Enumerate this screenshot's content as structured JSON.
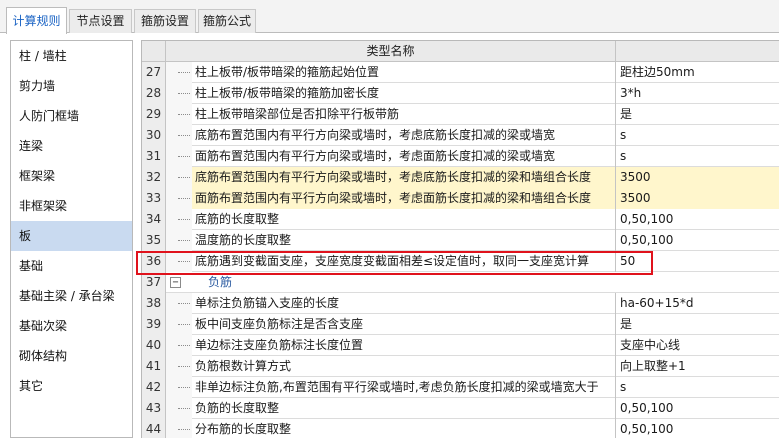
{
  "tabs": [
    {
      "label": "计算规则",
      "active": true
    },
    {
      "label": "节点设置",
      "active": false
    },
    {
      "label": "箍筋设置",
      "active": false
    },
    {
      "label": "箍筋公式",
      "active": false
    }
  ],
  "sidebar": {
    "selected": "板",
    "items": [
      "柱 / 墙柱",
      "剪力墙",
      "人防门框墙",
      "连梁",
      "框架梁",
      "非框架梁",
      "板",
      "基础",
      "基础主梁 / 承台梁",
      "基础次梁",
      "砌体结构",
      "其它"
    ]
  },
  "grid": {
    "header": "类型名称",
    "rows": [
      {
        "num": "27",
        "name": "柱上板带/板带暗梁的箍筋起始位置",
        "value": "距柱边50mm",
        "highlight": false
      },
      {
        "num": "28",
        "name": "柱上板带/板带暗梁的箍筋加密长度",
        "value": "3*h",
        "highlight": false
      },
      {
        "num": "29",
        "name": "柱上板带暗梁部位是否扣除平行板带筋",
        "value": "是",
        "highlight": false
      },
      {
        "num": "30",
        "name": "底筋布置范围内有平行方向梁或墙时，考虑底筋长度扣减的梁或墙宽",
        "value": "s",
        "highlight": false
      },
      {
        "num": "31",
        "name": "面筋布置范围内有平行方向梁或墙时，考虑面筋长度扣减的梁或墙宽",
        "value": "s",
        "highlight": false
      },
      {
        "num": "32",
        "name": "底筋布置范围内有平行方向梁或墙时，考虑底筋长度扣减的梁和墙组合长度",
        "value": "3500",
        "highlight": true
      },
      {
        "num": "33",
        "name": "面筋布置范围内有平行方向梁或墙时，考虑面筋长度扣减的梁和墙组合长度",
        "value": "3500",
        "highlight": true
      },
      {
        "num": "34",
        "name": "底筋的长度取整",
        "value": "0,50,100",
        "highlight": false
      },
      {
        "num": "35",
        "name": "温度筋的长度取整",
        "value": "0,50,100",
        "highlight": false
      },
      {
        "num": "36",
        "name": "底筋遇到变截面支座，支座宽度变截面相差≤设定值时，取同一支座宽计算",
        "value": "50",
        "highlight": false
      },
      {
        "num": "37",
        "group": true,
        "toggle": "−",
        "name": "负筋",
        "value": ""
      },
      {
        "num": "38",
        "name": "单标注负筋锚入支座的长度",
        "value": "ha-60+15*d",
        "highlight": false
      },
      {
        "num": "39",
        "name": "板中间支座负筋标注是否含支座",
        "value": "是",
        "highlight": false
      },
      {
        "num": "40",
        "name": "单边标注支座负筋标注长度位置",
        "value": "支座中心线",
        "highlight": false
      },
      {
        "num": "41",
        "name": "负筋根数计算方式",
        "value": "向上取整+1",
        "highlight": false
      },
      {
        "num": "42",
        "name": "非单边标注负筋,布置范围有平行梁或墙时,考虑负筋长度扣减的梁或墙宽大于",
        "value": "s",
        "highlight": false
      },
      {
        "num": "43",
        "name": "负筋的长度取整",
        "value": "0,50,100",
        "highlight": false
      },
      {
        "num": "44",
        "name": "分布筋的长度取整",
        "value": "0,50,100",
        "highlight": false
      }
    ]
  },
  "colors": {
    "accent_tab": "#1a63c4",
    "highlight_row": "#fff6cc",
    "selection_box": "#e0121c",
    "sidebar_selected": "#c9daf0"
  }
}
